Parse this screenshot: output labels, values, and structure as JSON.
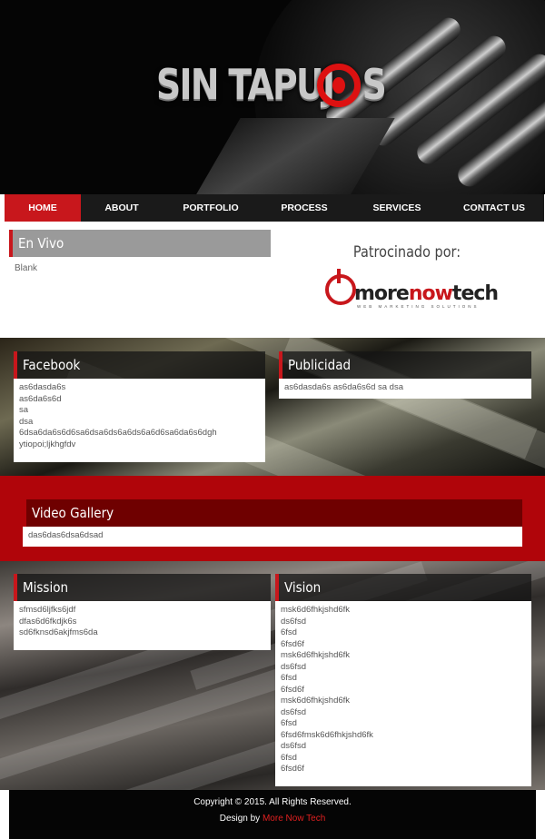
{
  "brand": {
    "logo_text": "SIN TAPUJ",
    "logo_tail": "S"
  },
  "nav": {
    "items": [
      "HOME",
      "ABOUT",
      "PORTFOLIO",
      "PROCESS",
      "SERVICES",
      "CONTACT US"
    ],
    "active_index": 0
  },
  "en_vivo": {
    "title": "En Vivo",
    "body": "Blank"
  },
  "sponsor": {
    "label": "Patrocinado por:",
    "logo_main": "more",
    "logo_accent": "now",
    "logo_end": "tech",
    "logo_sub": "WEB MARKETING SOLUTIONS"
  },
  "facebook": {
    "title": "Facebook",
    "lines": [
      "as6dasda6s",
      "as6da6s6d",
      "sa",
      "dsa",
      "6dsa6da6s6d6sa6dsa6ds6a6ds6a6d6sa6da6s6dgh",
      "ytiopoi;ljkhgfdv"
    ]
  },
  "publicidad": {
    "title": "Publicidad",
    "body": "as6dasda6s as6da6s6d sa dsa"
  },
  "video_gallery": {
    "title": "Video Gallery",
    "body": "das6das6dsa6dsad"
  },
  "mission": {
    "title": "Mission",
    "lines": [
      "sfmsd6ljfks6jdf",
      "dfas6d6fkdjk6s",
      "sd6fknsd6akjfms6da"
    ]
  },
  "vision": {
    "title": "Vision",
    "lines": [
      "msk6d6fhkjshd6fk",
      "ds6fsd",
      "6fsd",
      "6fsd6f",
      "msk6d6fhkjshd6fk",
      "ds6fsd",
      "6fsd",
      "6fsd6f",
      "msk6d6fhkjshd6fk",
      "ds6fsd",
      "6fsd",
      "6fsd6fmsk6d6fhkjshd6fk",
      "ds6fsd",
      "6fsd",
      "6fsd6f"
    ]
  },
  "footer": {
    "copyright": "Copyright © 2015. All Rights Reserved.",
    "design_prefix": "Design by ",
    "design_link": "More Now Tech"
  },
  "colors": {
    "accent": "#c8171c",
    "nav_bg": "#1a1a1a",
    "red_band": "#b0050a"
  }
}
